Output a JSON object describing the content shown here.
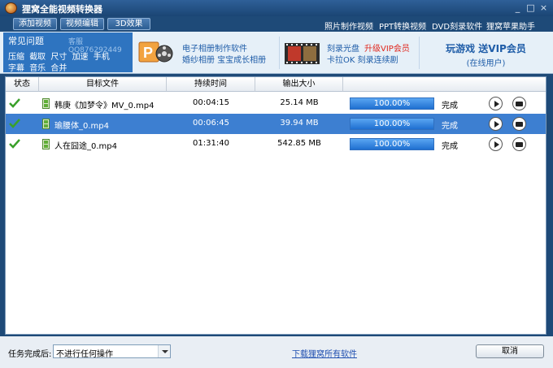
{
  "window": {
    "title": "狸窝全能视频转换器",
    "controls": {
      "minimize": "_",
      "maximize": "□",
      "close": "×"
    }
  },
  "toolbar": {
    "buttons": [
      "添加视频",
      "视频编辑",
      "3D效果"
    ],
    "links": [
      "照片制作视频",
      "PPT转换视频",
      "DVD刻录软件",
      "狸窝苹果助手"
    ]
  },
  "faq": {
    "title": "常见问题",
    "qq": "客服QQ876292449",
    "line1": [
      "压缩",
      "截取",
      "尺寸",
      "加速",
      "手机"
    ],
    "line2": [
      "字幕",
      "音乐",
      "合并"
    ]
  },
  "ads": {
    "album_software": "电子相册制作软件",
    "album_subs": "婚纱相册  宝宝成长相册",
    "burn_disc": "刻录光盘",
    "upgrade_vip": "升级VIP会员",
    "karaoke": "卡拉OK  刻录连续剧",
    "game_promo": "玩游戏  送VIP会员",
    "game_sub": "(在线用户)"
  },
  "list": {
    "headers": {
      "status": "状态",
      "file": "目标文件",
      "duration": "持续时间",
      "size": "输出大小"
    },
    "rows": [
      {
        "name": "韩庚《加梦令》MV_0.mp4",
        "duration": "00:04:15",
        "size": "25.14 MB",
        "progress_percent": 100,
        "progress_text": "100.00%",
        "state": "完成",
        "selected": false
      },
      {
        "name": "瑜腰体_0.mp4",
        "duration": "00:06:45",
        "size": "39.94 MB",
        "progress_percent": 100,
        "progress_text": "100.00%",
        "state": "完成",
        "selected": true
      },
      {
        "name": "人在囧途_0.mp4",
        "duration": "01:31:40",
        "size": "542.85 MB",
        "progress_percent": 100,
        "progress_text": "100.00%",
        "state": "完成",
        "selected": false
      }
    ]
  },
  "bottom": {
    "after_label": "任务完成后:",
    "after_value": "不进行任何操作",
    "download_link": "下载狸窝所有软件",
    "cancel": "取消"
  },
  "colors": {
    "titlebar": "#1e4a78",
    "selected_row": "#3d7fd1",
    "progress": "#1f6fd0",
    "check": "#3aa02a",
    "vip_red": "#e0281e",
    "link_blue": "#1f5da8"
  }
}
